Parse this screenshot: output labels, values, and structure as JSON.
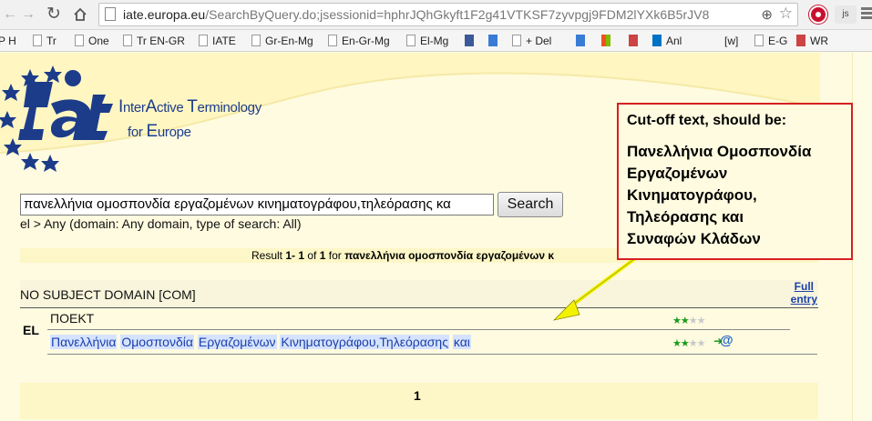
{
  "browser": {
    "url_host": "iate.europa.eu",
    "url_rest": "/SearchByQuery.do;jsessionid=hphrJQhGkyft1F2g41VTKSF7zyvpgj9FDM2lYXk6B5rJV8",
    "js_label": "js",
    "bookmarks": [
      "P H",
      "Tr",
      "One",
      "Tr EN-GR",
      "IATE",
      "Gr-En-Mg",
      "En-Gr-Mg",
      "El-Mg",
      "",
      "",
      "+ Del",
      "",
      "",
      "",
      "Anl",
      "[w]",
      "E-G",
      "WR"
    ]
  },
  "header": {
    "line1_parts": [
      "I",
      "nter",
      "A",
      "ctive ",
      "T",
      "erminology"
    ],
    "line2_parts": [
      "for ",
      "E",
      "urope"
    ]
  },
  "search": {
    "value": "πανελλήνια ομοσπονδία εργαζομένων κινηματογράφου,τηλεόρασης κα",
    "button_label": "Search",
    "breadcrumb": "el > Any (domain: Any domain, type of search: All)"
  },
  "results": {
    "summary_prefix": "Result ",
    "range": "1- 1",
    "of_word": " of ",
    "total": "1",
    "for_word": " for ",
    "query": "πανελλήνια ομοσπονδία εργαζομένων κ"
  },
  "entry": {
    "domain": "NO SUBJECT DOMAIN [COM]",
    "full_entry_line1": "Full",
    "full_entry_line2": "entry",
    "language": "EL",
    "term1": "ΠΟΕΚΤ",
    "term2_words": [
      "Πανελλήνια",
      "Ομοσπονδία",
      "Εργαζομένων",
      "Κινηματογράφου,Τηλεόρασης",
      "και"
    ],
    "reliability_stars_on": "★★",
    "reliability_stars_off": "★★"
  },
  "pager": {
    "current_page": "1"
  },
  "annotation": {
    "heading": "Cut-off text, should be:",
    "lines": [
      "Πανελλήνια Ομοσπονδία",
      "Εργαζομένων",
      "Κινηματογράφου,",
      "Τηλεόρασης και",
      "Συναφών Κλάδων"
    ]
  },
  "colors": {
    "page_bg": "#fffbe0",
    "highlight_bg": "#d6e3ff",
    "link_blue": "#1a3fa8",
    "callout_border": "#d62020",
    "arrow_yellow": "#f2f200"
  }
}
